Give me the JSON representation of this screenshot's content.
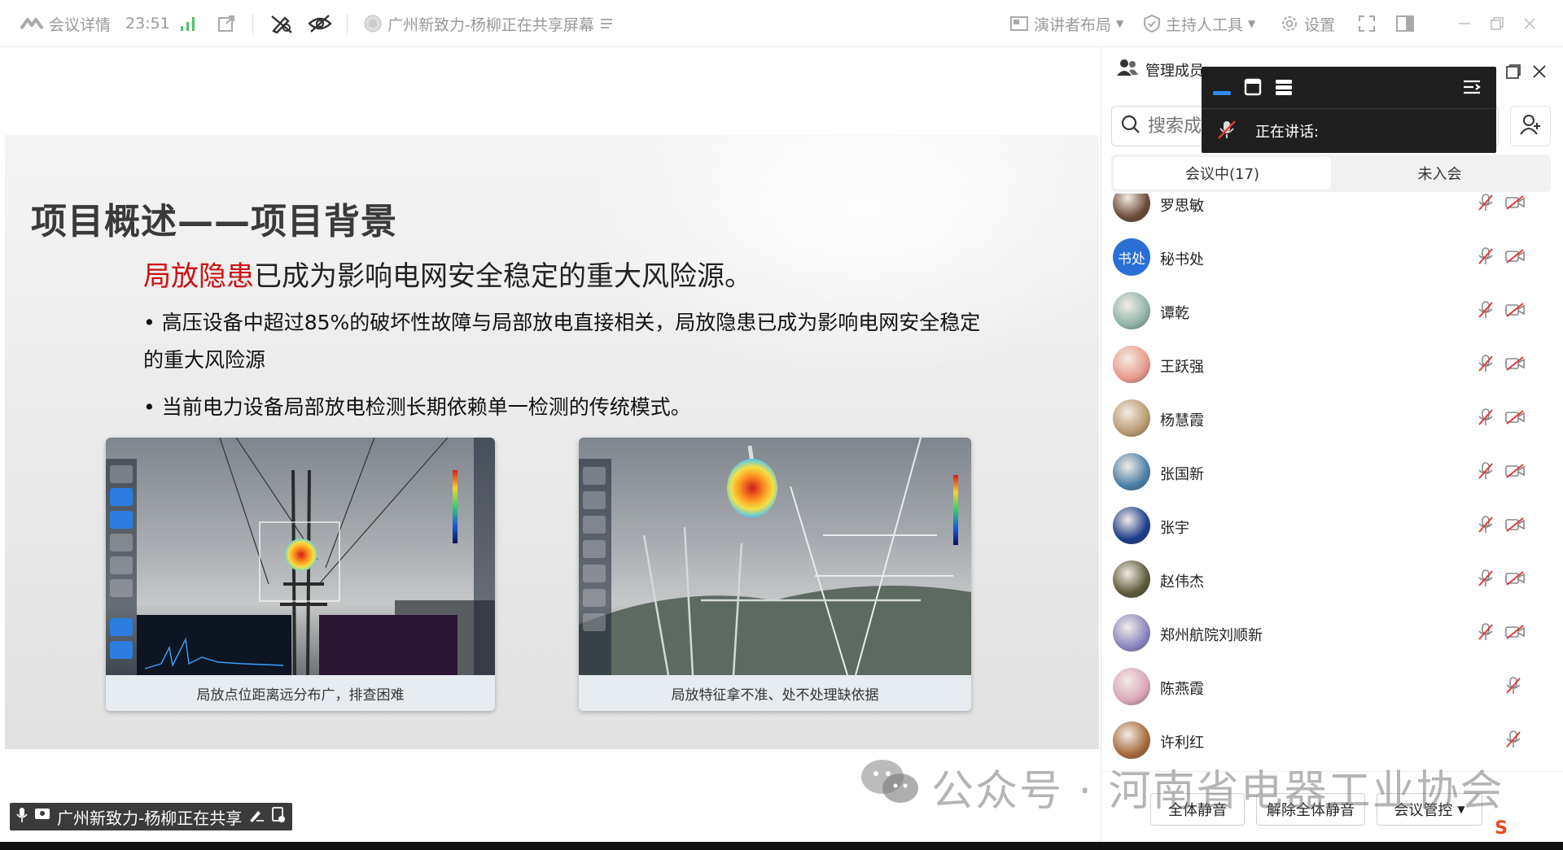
{
  "toolbar": {
    "meeting_details": "会议详情",
    "time": "23:51",
    "sharer_status": "广州新致力-杨柳正在共享屏幕",
    "presenter_layout": "演讲者布局",
    "host_tools": "主持人工具",
    "settings": "设置"
  },
  "slide": {
    "title": "项目概述——项目背景",
    "headline_highlight": "局放隐患",
    "headline_rest": "已成为影响电网安全稳定的重大风险源。",
    "bullet1": "• 高压设备中超过85%的破坏性故障与局部放电直接相关，局放隐患已成为影响电网安全稳定",
    "bullet1_cont": "的重大风险源",
    "bullet2": "• 当前电力设备局部放电检测长期依赖单一检测的传统模式。",
    "caption_left": "局放点位距离远分布广，排查困难",
    "caption_right": "局放特征拿不准、处不处理缺依据"
  },
  "share_label": "广州新致力-杨柳正在共享",
  "panel": {
    "title": "管理成员",
    "search_placeholder": "搜索成",
    "tab_in_meeting": "会议中(17)",
    "tab_not_joined": "未入会",
    "speaking_label": "正在讲话:",
    "members": [
      {
        "name": "罗思敏",
        "avatar": "photo",
        "color": "#6b4b3a",
        "cam": true
      },
      {
        "name": "秘书处",
        "avatar": "书处",
        "color": "#2a6fd6",
        "cam": true
      },
      {
        "name": "谭乾",
        "avatar": "photo",
        "color": "#8fb3a8",
        "cam": true
      },
      {
        "name": "王跃强",
        "avatar": "photo",
        "color": "#e89a8a",
        "cam": true
      },
      {
        "name": "杨慧霞",
        "avatar": "photo",
        "color": "#b99a72",
        "cam": true
      },
      {
        "name": "张国新",
        "avatar": "photo",
        "color": "#4a7fa8",
        "cam": true
      },
      {
        "name": "张宇",
        "avatar": "photo",
        "color": "#1c3c8c",
        "cam": true
      },
      {
        "name": "赵伟杰",
        "avatar": "photo",
        "color": "#5c5a3a",
        "cam": true
      },
      {
        "name": "郑州航院刘顺新",
        "avatar": "photo",
        "color": "#8a86c0",
        "cam": true
      },
      {
        "name": "陈燕霞",
        "avatar": "photo",
        "color": "#d9a6b8",
        "cam": false
      },
      {
        "name": "许利红",
        "avatar": "photo",
        "color": "#a86a3a",
        "cam": false
      }
    ],
    "mute_all": "全体静音",
    "unmute_all": "解除全体静音",
    "meeting_control": "会议管控"
  },
  "watermark": "公众号 · 河南省电器工业协会"
}
